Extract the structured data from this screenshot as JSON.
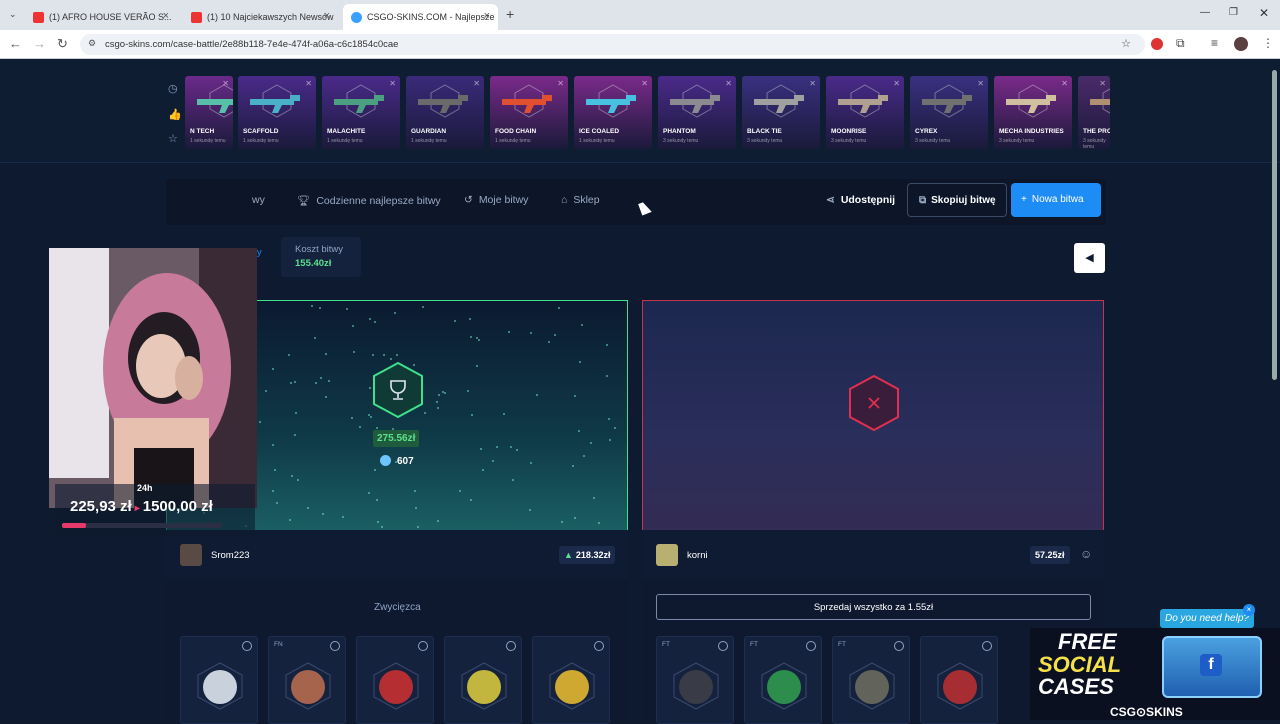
{
  "browser": {
    "tabs": [
      {
        "title": "(1) AFRO HOUSE VERÃO S...",
        "fav_color": "#e33"
      },
      {
        "title": "(1) 10 Najciekawszych Newsów",
        "fav_color": "#e33"
      },
      {
        "title": "CSGO-SKINS.COM - Najlepsze",
        "fav_color": "#3aa0ff"
      }
    ],
    "new_tab": "+",
    "url": "csgo-skins.com/case-battle/2e88b118-7e4e-474f-a06a-c6c1854c0cae"
  },
  "drops": [
    {
      "name": "N TECH",
      "ago": "1 sekundę temu",
      "bg": "#6a2a8a",
      "gun": "#58c0a8"
    },
    {
      "name": "SCAFFOLD",
      "ago": "1 sekundę temu",
      "bg": "#4a2a8a",
      "gun": "#4ab0c8"
    },
    {
      "name": "MALACHITE",
      "ago": "1 sekundę temu",
      "bg": "#4a2a8a",
      "gun": "#4aa080"
    },
    {
      "name": "GUARDIAN",
      "ago": "1 sekundę temu",
      "bg": "#3a2a7a",
      "gun": "#6a6a6a"
    },
    {
      "name": "FOOD CHAIN",
      "ago": "1 sekundę temu",
      "bg": "#7a2a8a",
      "gun": "#e05030"
    },
    {
      "name": "ICE COALED",
      "ago": "1 sekundę temu",
      "bg": "#7a2a8a",
      "gun": "#48c0e0"
    },
    {
      "name": "PHANTOM",
      "ago": "3 sekundy temu",
      "bg": "#4a2a8a",
      "gun": "#8a8a90"
    },
    {
      "name": "BLACK TIE",
      "ago": "3 sekundy temu",
      "bg": "#3a3080",
      "gun": "#a0a0a0"
    },
    {
      "name": "MOONRISE",
      "ago": "3 sekundy temu",
      "bg": "#4a2a8a",
      "gun": "#b0a090"
    },
    {
      "name": "CYREX",
      "ago": "3 sekundy temu",
      "bg": "#3a3080",
      "gun": "#707070"
    },
    {
      "name": "MECHA INDUSTRIES",
      "ago": "3 sekundy temu",
      "bg": "#7a2a8a",
      "gun": "#d0c0a0"
    },
    {
      "name": "THE PROFES",
      "ago": "3 sekundy temu",
      "bg": "#4a2a6a",
      "gun": "#b09070"
    }
  ],
  "nav": {
    "left_cut": "wy",
    "daily": "Codzienne najlepsze bitwy",
    "my": "Moje bitwy",
    "shop": "Sklep",
    "share": "Udostępnij",
    "copy": "Skopiuj bitwę",
    "new": "Nowa bitwa"
  },
  "battle": {
    "left_tab": "wy",
    "cost_label": "Koszt bitwy",
    "cost_value": "155.40zł",
    "winner_amount": "275.56zł",
    "coins": "607",
    "winner_label": "Zwycięzca",
    "sell_all": "Sprzedaj wszystko za 1.55zł"
  },
  "players": [
    {
      "name": "Srom223",
      "score": "218.32zł"
    },
    {
      "name": "korni",
      "score": "57.25zł"
    }
  ],
  "cards_left": [
    {
      "q": "",
      "c": "#e8f0f8"
    },
    {
      "q": "FN",
      "c": "#c07050"
    },
    {
      "q": "",
      "c": "#d03030"
    },
    {
      "q": "",
      "c": "#e0d040"
    },
    {
      "q": "",
      "c": "#f0c030"
    }
  ],
  "cards_right": [
    {
      "q": "FT",
      "c": "#404048"
    },
    {
      "q": "FT",
      "c": "#30a050"
    },
    {
      "q": "FT",
      "c": "#707060"
    },
    {
      "q": "",
      "c": "#c03030"
    }
  ],
  "stream": {
    "timer": "24h",
    "goal_current": "225,93 zł",
    "goal_target": "1500,00 zł",
    "goal_progress": 0.15
  },
  "promo": {
    "help": "Do you need help?",
    "line1": "FREE",
    "line2": "SOCIAL",
    "line3": "CASES",
    "brand": "CSG⊙SKINS"
  }
}
